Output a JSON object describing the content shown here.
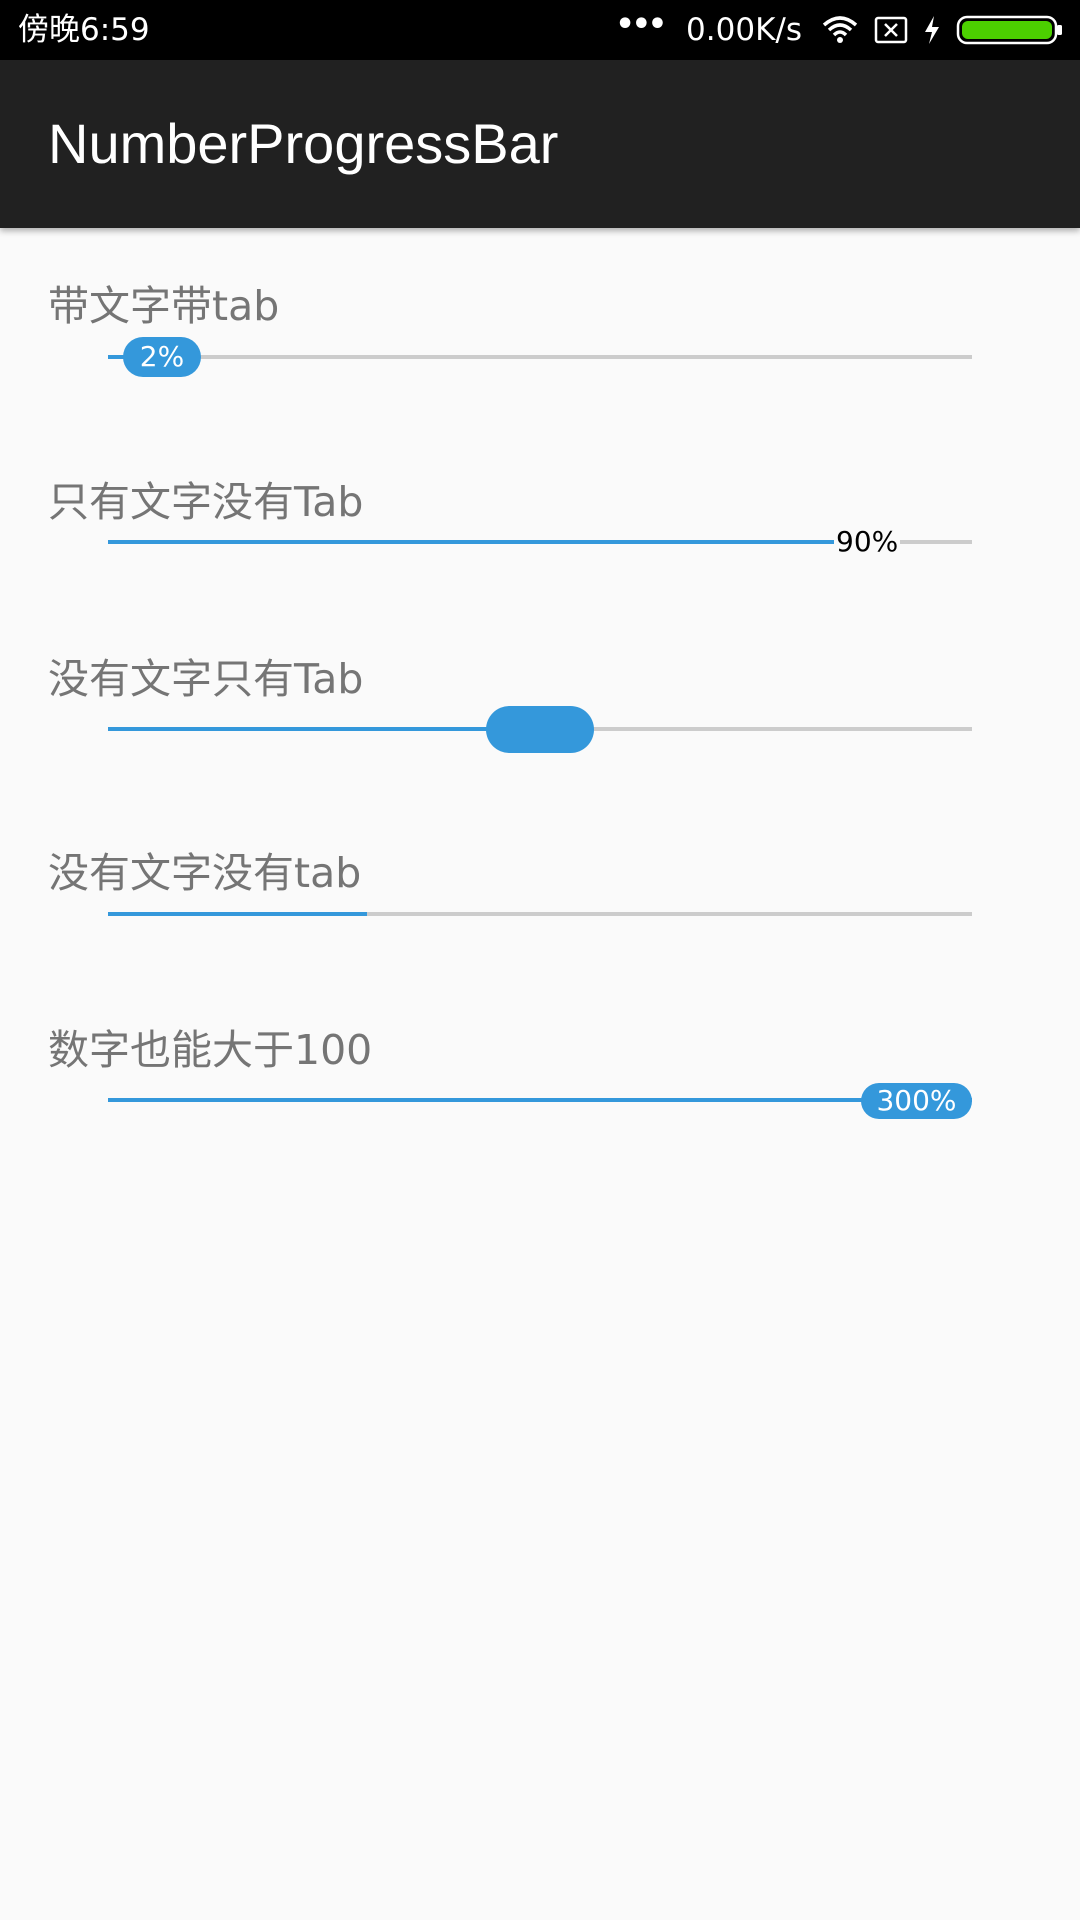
{
  "status_bar": {
    "time": "傍晚6:59",
    "network_speed": "0.00K/s",
    "icons": [
      "more-dots-icon",
      "wifi-icon",
      "sim-blocked-icon",
      "charging-bolt-icon",
      "battery-icon"
    ],
    "battery_color": "#4cd000"
  },
  "app_bar": {
    "title": "NumberProgressBar",
    "background": "#212121"
  },
  "colors": {
    "accent": "#3498db",
    "track": "#cccccc",
    "label": "#757575"
  },
  "progress_items": [
    {
      "label": "带文字带tab",
      "progress_text": "2%",
      "progress": 0.02,
      "show_text": true,
      "show_tab": true
    },
    {
      "label": "只有文字没有Tab",
      "progress_text": "90%",
      "progress": 0.9,
      "show_text": true,
      "show_tab": false
    },
    {
      "label": "没有文字只有Tab",
      "progress": 0.5,
      "show_text": false,
      "show_tab": true
    },
    {
      "label": "没有文字没有tab",
      "progress": 0.3,
      "show_text": false,
      "show_tab": false
    },
    {
      "label": "数字也能大于100",
      "progress_text": "300%",
      "progress": 3.0,
      "show_text": true,
      "show_tab": true
    }
  ]
}
